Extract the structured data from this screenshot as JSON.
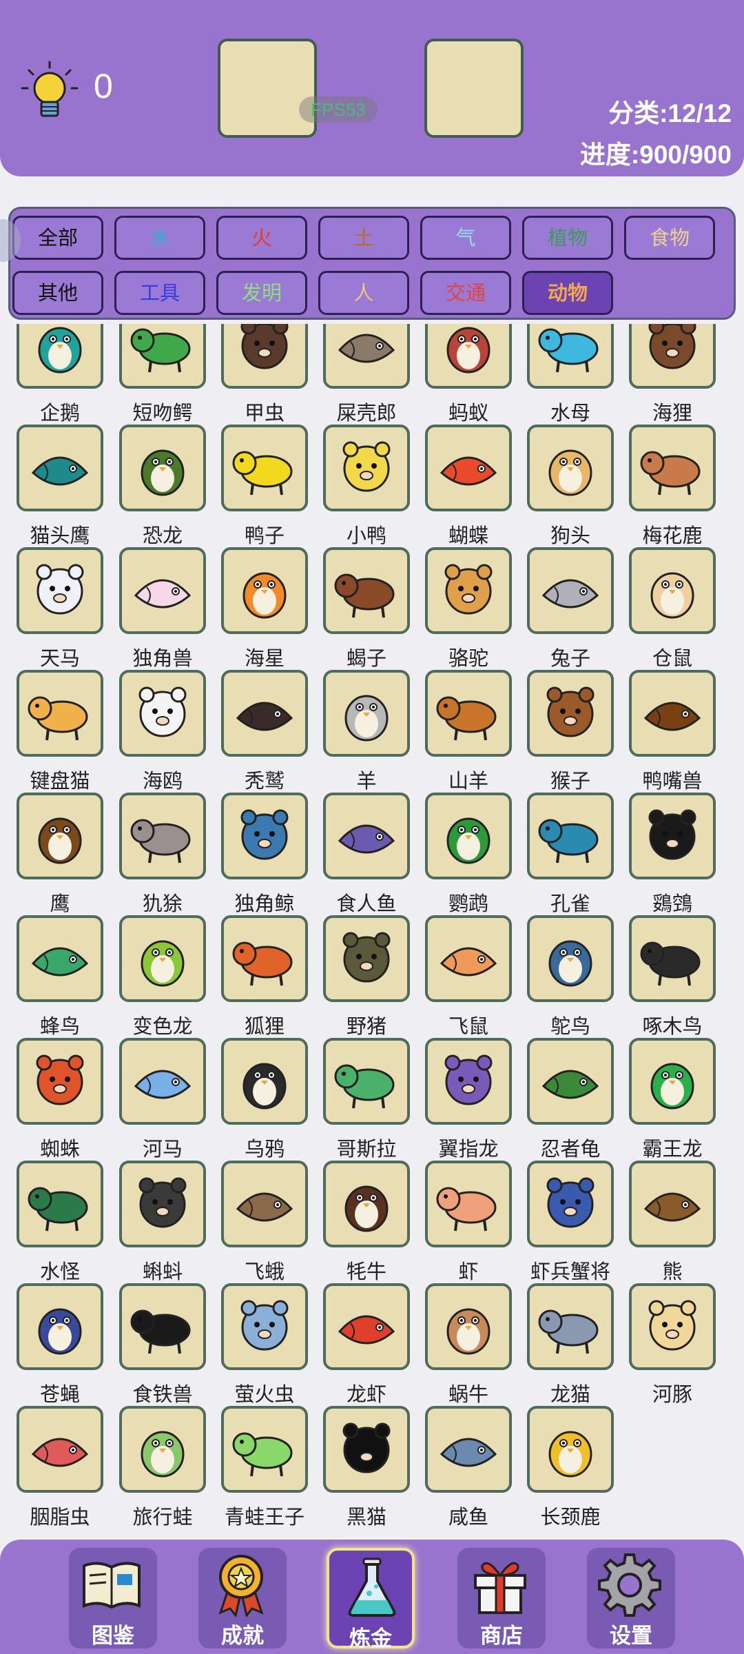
{
  "header": {
    "hint_count": "0",
    "fps": "FPS53",
    "category_count": "分类:12/12",
    "progress": "进度:900/900"
  },
  "filters": [
    {
      "label": "全部",
      "color": "#111111"
    },
    {
      "label": "水",
      "color": "#2bb3c8"
    },
    {
      "label": "火",
      "color": "#e53b2b"
    },
    {
      "label": "土",
      "color": "#b86b2a"
    },
    {
      "label": "气",
      "color": "#8de0ea"
    },
    {
      "label": "植物",
      "color": "#3f9a5a"
    },
    {
      "label": "食物",
      "color": "#f0d08a"
    },
    {
      "label": "其他",
      "color": "#111111"
    },
    {
      "label": "工具",
      "color": "#3a3ae0"
    },
    {
      "label": "发明",
      "color": "#8fe07e"
    },
    {
      "label": "人",
      "color": "#f2c27e"
    },
    {
      "label": "交通",
      "color": "#e0443c"
    },
    {
      "label": "动物",
      "color": "#f2a84c",
      "active": true
    }
  ],
  "animals": [
    {
      "label": "企鹅",
      "icon": "penguin-icon",
      "color": "#1fa39a"
    },
    {
      "label": "短吻鳄",
      "icon": "alligator-icon",
      "color": "#3ea84a"
    },
    {
      "label": "甲虫",
      "icon": "beetle-icon",
      "color": "#5a3a2a"
    },
    {
      "label": "屎壳郎",
      "icon": "dung-beetle-icon",
      "color": "#8a7a6a"
    },
    {
      "label": "蚂蚁",
      "icon": "ant-icon",
      "color": "#b8443a"
    },
    {
      "label": "水母",
      "icon": "jellyfish-icon",
      "color": "#3fb8e0"
    },
    {
      "label": "海狸",
      "icon": "beaver-icon",
      "color": "#7a4a2a"
    },
    {
      "label": "猫头鹰",
      "icon": "owl-icon",
      "color": "#1f8a8a"
    },
    {
      "label": "恐龙",
      "icon": "dinosaur-icon",
      "color": "#4a7a2a"
    },
    {
      "label": "鸭子",
      "icon": "duck-icon",
      "color": "#f2d81f"
    },
    {
      "label": "小鸭",
      "icon": "duckling-icon",
      "color": "#f2d84a"
    },
    {
      "label": "蝴蝶",
      "icon": "butterfly-icon",
      "color": "#e84a2a"
    },
    {
      "label": "狗头",
      "icon": "doge-icon",
      "color": "#e8b86a"
    },
    {
      "label": "梅花鹿",
      "icon": "sika-deer-icon",
      "color": "#c87a4a"
    },
    {
      "label": "天马",
      "icon": "pegasus-icon",
      "color": "#f0f0f8"
    },
    {
      "label": "独角兽",
      "icon": "unicorn-icon",
      "color": "#f6d8e8"
    },
    {
      "label": "海星",
      "icon": "starfish-icon",
      "color": "#f08a2a"
    },
    {
      "label": "蝎子",
      "icon": "scorpion-icon",
      "color": "#8a4a2a"
    },
    {
      "label": "骆驼",
      "icon": "camel-icon",
      "color": "#e0a04a"
    },
    {
      "label": "兔子",
      "icon": "rabbit-icon",
      "color": "#b0b0b8"
    },
    {
      "label": "仓鼠",
      "icon": "hamster-icon",
      "color": "#f0d0a0"
    },
    {
      "label": "键盘猫",
      "icon": "keyboard-cat-icon",
      "color": "#f0b04a"
    },
    {
      "label": "海鸥",
      "icon": "seagull-icon",
      "color": "#f4f4f4"
    },
    {
      "label": "秃鹫",
      "icon": "vulture-icon",
      "color": "#3a2a2a"
    },
    {
      "label": "羊",
      "icon": "goat-icon",
      "color": "#b8b8b8"
    },
    {
      "label": "山羊",
      "icon": "mountain-goat-icon",
      "color": "#c8742a"
    },
    {
      "label": "猴子",
      "icon": "monkey-icon",
      "color": "#9a5a2a"
    },
    {
      "label": "鸭嘴兽",
      "icon": "platypus-icon",
      "color": "#7a4012"
    },
    {
      "label": "鹰",
      "icon": "eagle-icon",
      "color": "#7a4a1a"
    },
    {
      "label": "犰狳",
      "icon": "armadillo-icon",
      "color": "#9a9090"
    },
    {
      "label": "独角鲸",
      "icon": "narwhal-icon",
      "color": "#3a7ab0"
    },
    {
      "label": "食人鱼",
      "icon": "piranha-icon",
      "color": "#6a5ab0"
    },
    {
      "label": "鹦鹉",
      "icon": "parrot-icon",
      "color": "#2a9a3a"
    },
    {
      "label": "孔雀",
      "icon": "peacock-icon",
      "color": "#2a8ab0"
    },
    {
      "label": "鵎鵼",
      "icon": "toucan-icon",
      "color": "#1a1a1a"
    },
    {
      "label": "蜂鸟",
      "icon": "hummingbird-icon",
      "color": "#3aa86a"
    },
    {
      "label": "变色龙",
      "icon": "chameleon-icon",
      "color": "#8ac83a"
    },
    {
      "label": "狐狸",
      "icon": "fox-icon",
      "color": "#e0642a"
    },
    {
      "label": "野猪",
      "icon": "boar-icon",
      "color": "#5a5a3a"
    },
    {
      "label": "飞鼠",
      "icon": "flying-squirrel-icon",
      "color": "#f09a5a"
    },
    {
      "label": "鸵鸟",
      "icon": "ostrich-icon",
      "color": "#3a6a9a"
    },
    {
      "label": "啄木鸟",
      "icon": "woodpecker-icon",
      "color": "#2a2a2a"
    },
    {
      "label": "蜘蛛",
      "icon": "spider-icon",
      "color": "#e0542a"
    },
    {
      "label": "河马",
      "icon": "hippo-icon",
      "color": "#7ab0e8"
    },
    {
      "label": "乌鸦",
      "icon": "crow-icon",
      "color": "#2a2a2a"
    },
    {
      "label": "哥斯拉",
      "icon": "godzilla-icon",
      "color": "#4ab06a"
    },
    {
      "label": "翼指龙",
      "icon": "pterodactyl-icon",
      "color": "#7a5ab8"
    },
    {
      "label": "忍者龟",
      "icon": "ninja-turtle-icon",
      "color": "#3a8a3a"
    },
    {
      "label": "霸王龙",
      "icon": "t-rex-icon",
      "color": "#2ab04a"
    },
    {
      "label": "水怪",
      "icon": "sea-monster-icon",
      "color": "#2a7a4a"
    },
    {
      "label": "蝌蚪",
      "icon": "tadpole-icon",
      "color": "#3a3a3a"
    },
    {
      "label": "飞蛾",
      "icon": "moth-icon",
      "color": "#8a6a4a"
    },
    {
      "label": "牦牛",
      "icon": "yak-icon",
      "color": "#5a3020"
    },
    {
      "label": "虾",
      "icon": "shrimp-icon",
      "color": "#f0a07a"
    },
    {
      "label": "虾兵蟹将",
      "icon": "shrimp-soldiers-icon",
      "color": "#3a5ab0"
    },
    {
      "label": "熊",
      "icon": "bear-icon",
      "color": "#8a5a2a"
    },
    {
      "label": "苍蝇",
      "icon": "fly-icon",
      "color": "#3a4a9a"
    },
    {
      "label": "食铁兽",
      "icon": "panda-icon",
      "color": "#1a1a1a"
    },
    {
      "label": "萤火虫",
      "icon": "firefly-icon",
      "color": "#8ab0d8"
    },
    {
      "label": "龙虾",
      "icon": "lobster-icon",
      "color": "#e0402a"
    },
    {
      "label": "蜗牛",
      "icon": "snail-icon",
      "color": "#c88a5a"
    },
    {
      "label": "龙猫",
      "icon": "totoro-icon",
      "color": "#8a98b0"
    },
    {
      "label": "河豚",
      "icon": "pufferfish-icon",
      "color": "#f0d89a"
    },
    {
      "label": "胭脂虫",
      "icon": "cochineal-icon",
      "color": "#e05a5a"
    },
    {
      "label": "旅行蛙",
      "icon": "travel-frog-icon",
      "color": "#8ac86a"
    },
    {
      "label": "青蛙王子",
      "icon": "frog-prince-icon",
      "color": "#8ad86a"
    },
    {
      "label": "黑猫",
      "icon": "black-cat-icon",
      "color": "#111111"
    },
    {
      "label": "咸鱼",
      "icon": "salted-fish-icon",
      "color": "#6a8ab0"
    },
    {
      "label": "长颈鹿",
      "icon": "giraffe-icon",
      "color": "#f0c02a"
    }
  ],
  "nav": [
    {
      "label": "图鉴",
      "icon": "book-icon"
    },
    {
      "label": "成就",
      "icon": "medal-icon"
    },
    {
      "label": "炼金",
      "icon": "flask-icon",
      "active": true
    },
    {
      "label": "商店",
      "icon": "gift-icon"
    },
    {
      "label": "设置",
      "icon": "gear-icon"
    }
  ]
}
